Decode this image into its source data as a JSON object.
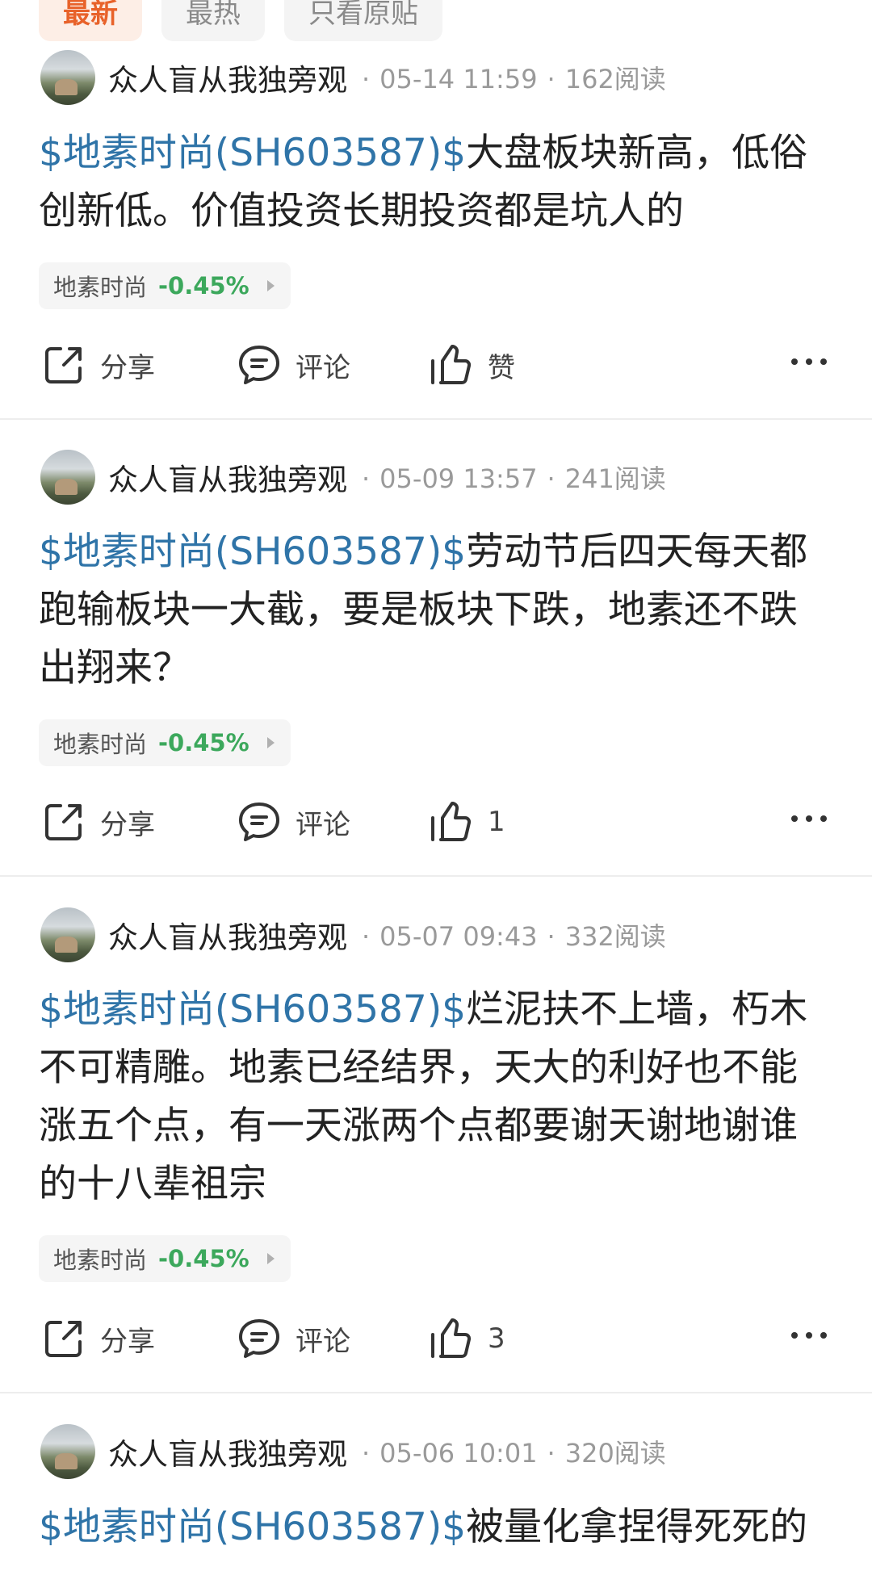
{
  "tabs": [
    {
      "label": "最新",
      "active": true
    },
    {
      "label": "最热",
      "active": false
    },
    {
      "label": "只看原贴",
      "active": false
    }
  ],
  "colors": {
    "accent": "#e8622a",
    "link": "#2f74a8",
    "down": "#3ca85c"
  },
  "actions": {
    "share": "分享",
    "comment": "评论",
    "like": "赞"
  },
  "posts": [
    {
      "author": "众人盲从我独旁观",
      "time": "05-14 11:59",
      "reads": "162阅读",
      "stock_tag": "$地素时尚(SH603587)$",
      "text": "大盘板块新高，低俗创新低。价值投资长期投资都是坑人的",
      "chip_name": "地素时尚",
      "chip_change": "-0.45%",
      "likes": "赞"
    },
    {
      "author": "众人盲从我独旁观",
      "time": "05-09 13:57",
      "reads": "241阅读",
      "stock_tag": "$地素时尚(SH603587)$",
      "text": "劳动节后四天每天都跑输板块一大截，要是板块下跌，地素还不跌出翔来？",
      "chip_name": "地素时尚",
      "chip_change": "-0.45%",
      "likes": "1"
    },
    {
      "author": "众人盲从我独旁观",
      "time": "05-07 09:43",
      "reads": "332阅读",
      "stock_tag": "$地素时尚(SH603587)$",
      "text": "烂泥扶不上墙，朽木不可精雕。地素已经结界，天大的利好也不能涨五个点，有一天涨两个点都要谢天谢地谢谁的十八辈祖宗",
      "chip_name": "地素时尚",
      "chip_change": "-0.45%",
      "likes": "3"
    },
    {
      "author": "众人盲从我独旁观",
      "time": "05-06 10:01",
      "reads": "320阅读",
      "stock_tag": "$地素时尚(SH603587)$",
      "text": "被量化拿捏得死死的"
    }
  ]
}
